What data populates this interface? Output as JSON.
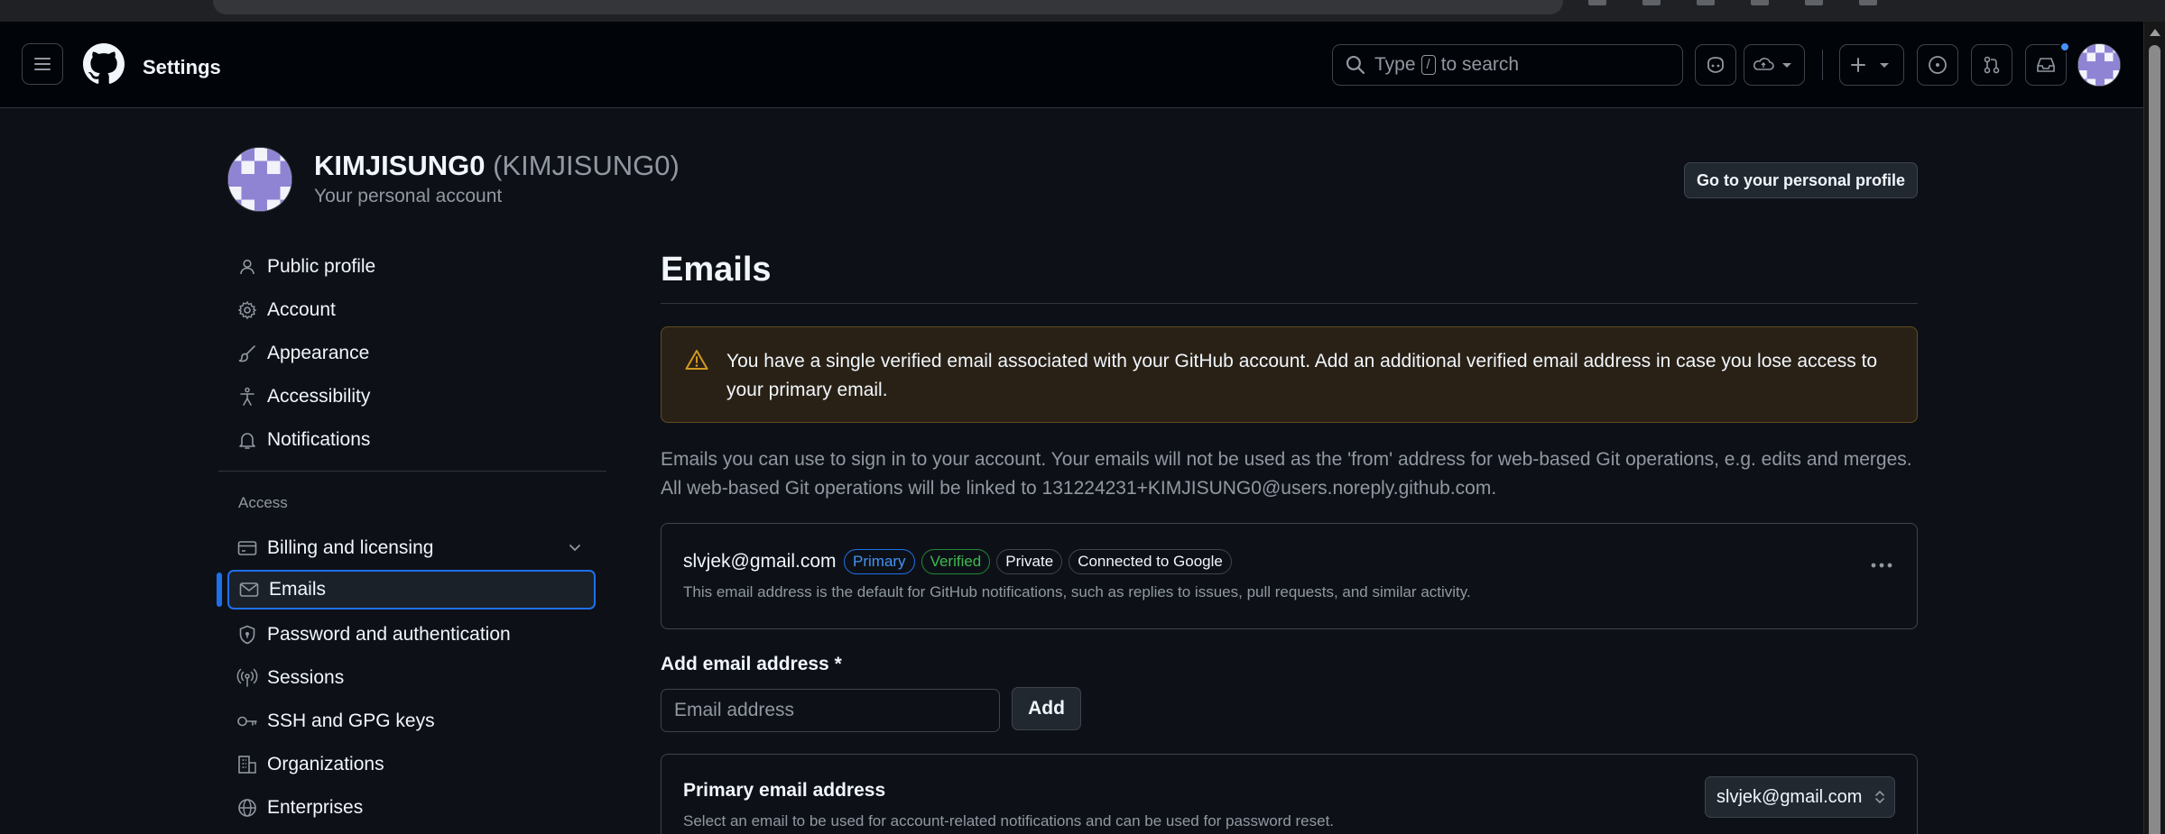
{
  "header": {
    "title": "Settings",
    "search_prefix": "Type",
    "search_key": "/",
    "search_suffix": "to search"
  },
  "profile": {
    "name": "KIMJISUNG0",
    "login": "(KIMJISUNG0)",
    "subtitle": "Your personal account",
    "profile_button": "Go to your personal profile"
  },
  "sidebar": {
    "items": [
      {
        "label": "Public profile",
        "icon": "person-icon"
      },
      {
        "label": "Account",
        "icon": "gear-icon"
      },
      {
        "label": "Appearance",
        "icon": "paintbrush-icon"
      },
      {
        "label": "Accessibility",
        "icon": "accessibility-icon"
      },
      {
        "label": "Notifications",
        "icon": "bell-icon"
      }
    ],
    "access_heading": "Access",
    "access_items": [
      {
        "label": "Billing and licensing",
        "icon": "credit-card-icon"
      },
      {
        "label": "Emails",
        "icon": "mail-icon"
      },
      {
        "label": "Password and authentication",
        "icon": "shield-lock-icon"
      },
      {
        "label": "Sessions",
        "icon": "broadcast-icon"
      },
      {
        "label": "SSH and GPG keys",
        "icon": "key-icon"
      },
      {
        "label": "Organizations",
        "icon": "organization-icon"
      },
      {
        "label": "Enterprises",
        "icon": "globe-icon"
      }
    ]
  },
  "main": {
    "title": "Emails",
    "warning": "You have a single verified email associated with your GitHub account. Add an additional verified email address in case you lose access to your primary email.",
    "description": "Emails you can use to sign in to your account. Your emails will not be used as the 'from' address for web-based Git operations, e.g. edits and merges. All web-based Git operations will be linked to 131224231+KIMJISUNG0@users.noreply.github.com.",
    "email": {
      "address": "slvjek@gmail.com",
      "badges": {
        "primary": "Primary",
        "verified": "Verified",
        "private": "Private",
        "connected": "Connected to Google"
      },
      "note": "This email address is the default for GitHub notifications, such as replies to issues, pull requests, and similar activity."
    },
    "add": {
      "label": "Add email address *",
      "placeholder": "Email address",
      "value": "",
      "button": "Add"
    },
    "primary": {
      "title": "Primary email address",
      "note": "Select an email to be used for account-related notifications and can be used for password reset.",
      "selected": "slvjek@gmail.com"
    }
  },
  "colors": {
    "accent": "#1f6feb",
    "warning": "#d29922",
    "success": "#3fb950",
    "background": "#0d1117"
  }
}
